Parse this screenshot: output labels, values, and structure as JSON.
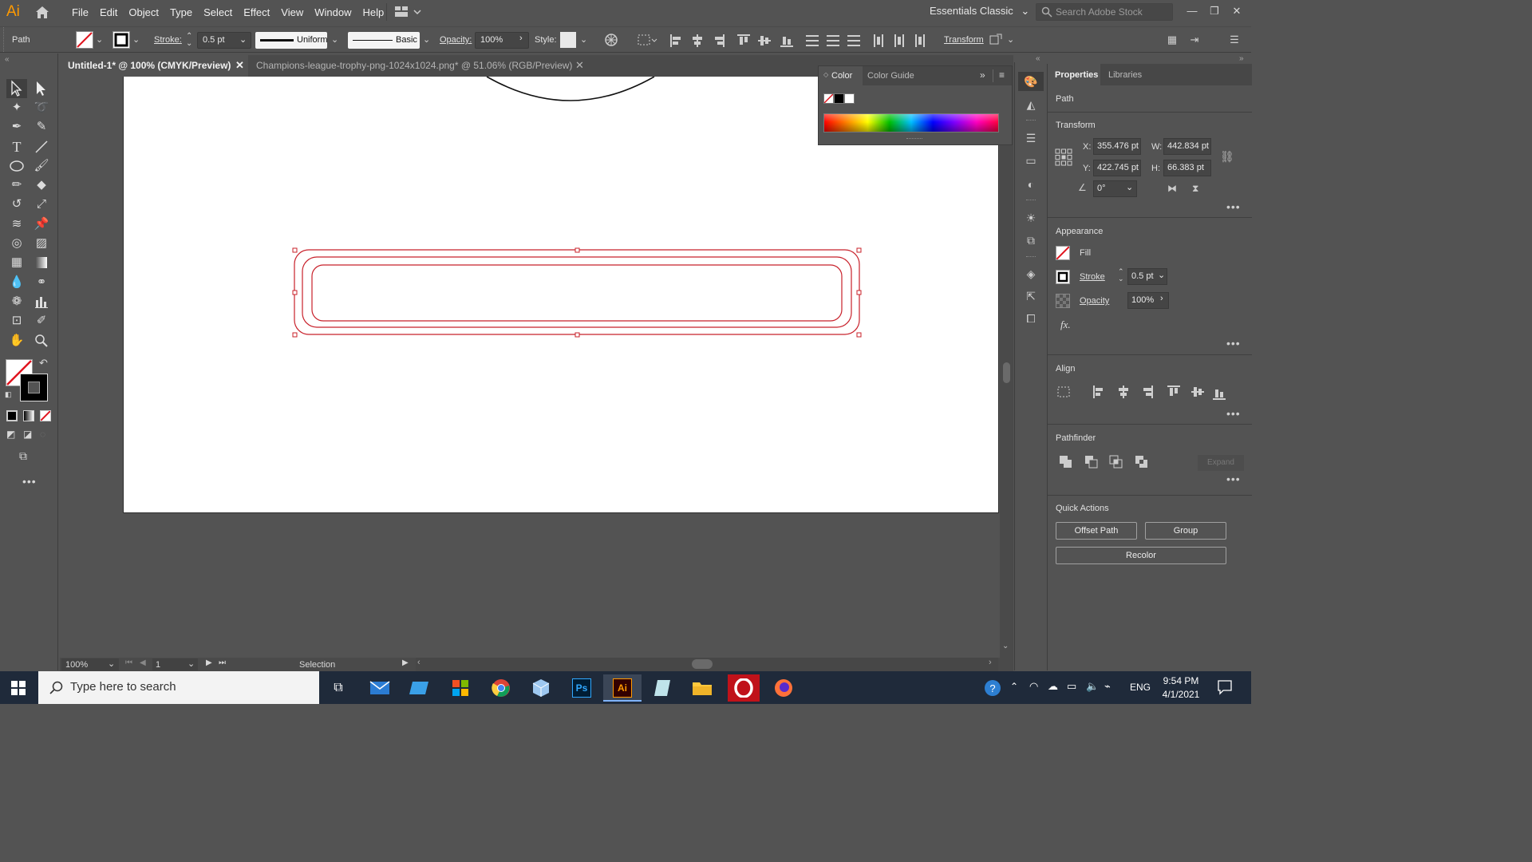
{
  "app": {
    "logo": "Ai",
    "menu": [
      "File",
      "Edit",
      "Object",
      "Type",
      "Select",
      "Effect",
      "View",
      "Window",
      "Help"
    ],
    "workspace": "Essentials Classic",
    "search_placeholder": "Search Adobe Stock"
  },
  "control": {
    "selection_type": "Path",
    "stroke_label": "Stroke:",
    "stroke_value": "0.5 pt",
    "profile": "Uniform",
    "brush": "Basic",
    "opacity_label": "Opacity:",
    "opacity_value": "100%",
    "style_label": "Style:",
    "transform_label": "Transform"
  },
  "tabs": [
    {
      "label": "Untitled-1* @ 100% (CMYK/Preview)",
      "active": true
    },
    {
      "label": "Champions-league-trophy-png-1024x1024.png* @ 51.06% (RGB/Preview)",
      "active": false
    }
  ],
  "color_panel": {
    "tabs": [
      "Color",
      "Color Guide"
    ]
  },
  "properties": {
    "tabs": [
      "Properties",
      "Libraries"
    ],
    "selection": "Path",
    "transform": {
      "title": "Transform",
      "x_label": "X:",
      "x": "355.476 pt",
      "y_label": "Y:",
      "y": "422.745 pt",
      "w_label": "W:",
      "w": "442.834 pt",
      "h_label": "H:",
      "h": "66.383 pt",
      "angle": "0°"
    },
    "appearance": {
      "title": "Appearance",
      "fill_label": "Fill",
      "stroke_label": "Stroke",
      "stroke_value": "0.5 pt",
      "opacity_label": "Opacity",
      "opacity_value": "100%",
      "fx_label": "fx."
    },
    "align_title": "Align",
    "pathfinder": {
      "title": "Pathfinder",
      "expand_label": "Expand"
    },
    "quick_actions": {
      "title": "Quick Actions",
      "offset_path": "Offset Path",
      "group": "Group",
      "recolor": "Recolor"
    }
  },
  "status": {
    "zoom": "100%",
    "artboard": "1",
    "tool": "Selection"
  },
  "taskbar": {
    "search_placeholder": "Type here to search",
    "language": "ENG",
    "time": "9:54 PM",
    "date": "4/1/2021"
  },
  "colors": {
    "selection_red": "#c8202a",
    "app_bg": "#535353",
    "ai_orange": "#ff9a00"
  }
}
